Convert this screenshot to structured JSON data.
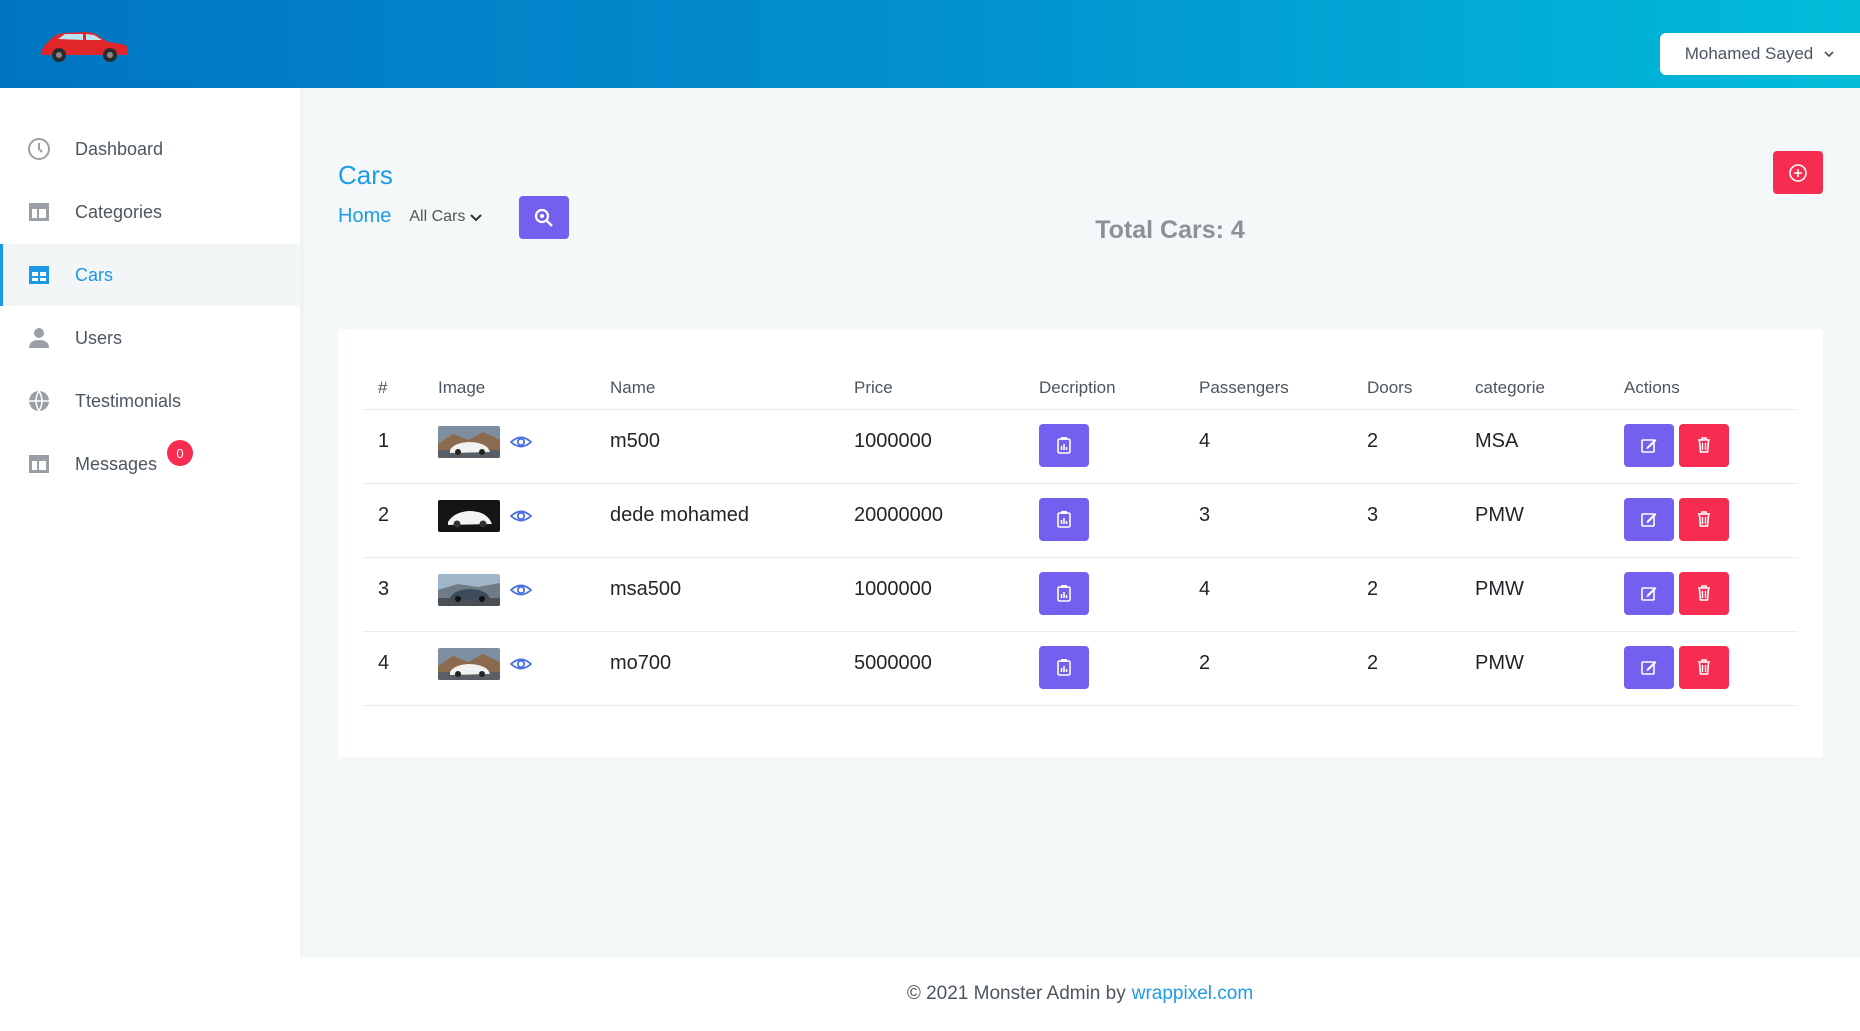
{
  "header": {
    "user_name": "Mohamed Sayed"
  },
  "sidebar": {
    "items": [
      {
        "label": "Dashboard",
        "icon": "clock-icon"
      },
      {
        "label": "Categories",
        "icon": "layout-icon"
      },
      {
        "label": "Cars",
        "icon": "grid-icon",
        "active": true
      },
      {
        "label": "Users",
        "icon": "user-icon"
      },
      {
        "label": "Ttestimonials",
        "icon": "globe-icon"
      },
      {
        "label": "Messages",
        "icon": "layout-icon",
        "badge": "0"
      }
    ]
  },
  "page": {
    "title": "Cars",
    "breadcrumb_home": "Home",
    "filter_value": "All Cars",
    "total_cars": "Total Cars: 4"
  },
  "table": {
    "headers": [
      "#",
      "Image",
      "Name",
      "Price",
      "Decription",
      "Passengers",
      "Doors",
      "categorie",
      "Actions"
    ],
    "rows": [
      {
        "num": "1",
        "name": "m500",
        "price": "1000000",
        "passengers": "4",
        "doors": "2",
        "category": "MSA",
        "thumb": "white-car-mountain"
      },
      {
        "num": "2",
        "name": "dede mohamed",
        "price": "20000000",
        "passengers": "3",
        "doors": "3",
        "category": "PMW",
        "thumb": "white-car-dark"
      },
      {
        "num": "3",
        "name": "msa500",
        "price": "1000000",
        "passengers": "4",
        "doors": "2",
        "category": "PMW",
        "thumb": "dark-car-sky"
      },
      {
        "num": "4",
        "name": "mo700",
        "price": "5000000",
        "passengers": "2",
        "doors": "2",
        "category": "PMW",
        "thumb": "white-car-mountain"
      }
    ]
  },
  "footer": {
    "text": "© 2021 Monster Admin by",
    "link": "wrappixel.com"
  },
  "colors": {
    "primary": "#1e9ce6",
    "purple": "#7460ee",
    "danger": "#f62d51"
  }
}
